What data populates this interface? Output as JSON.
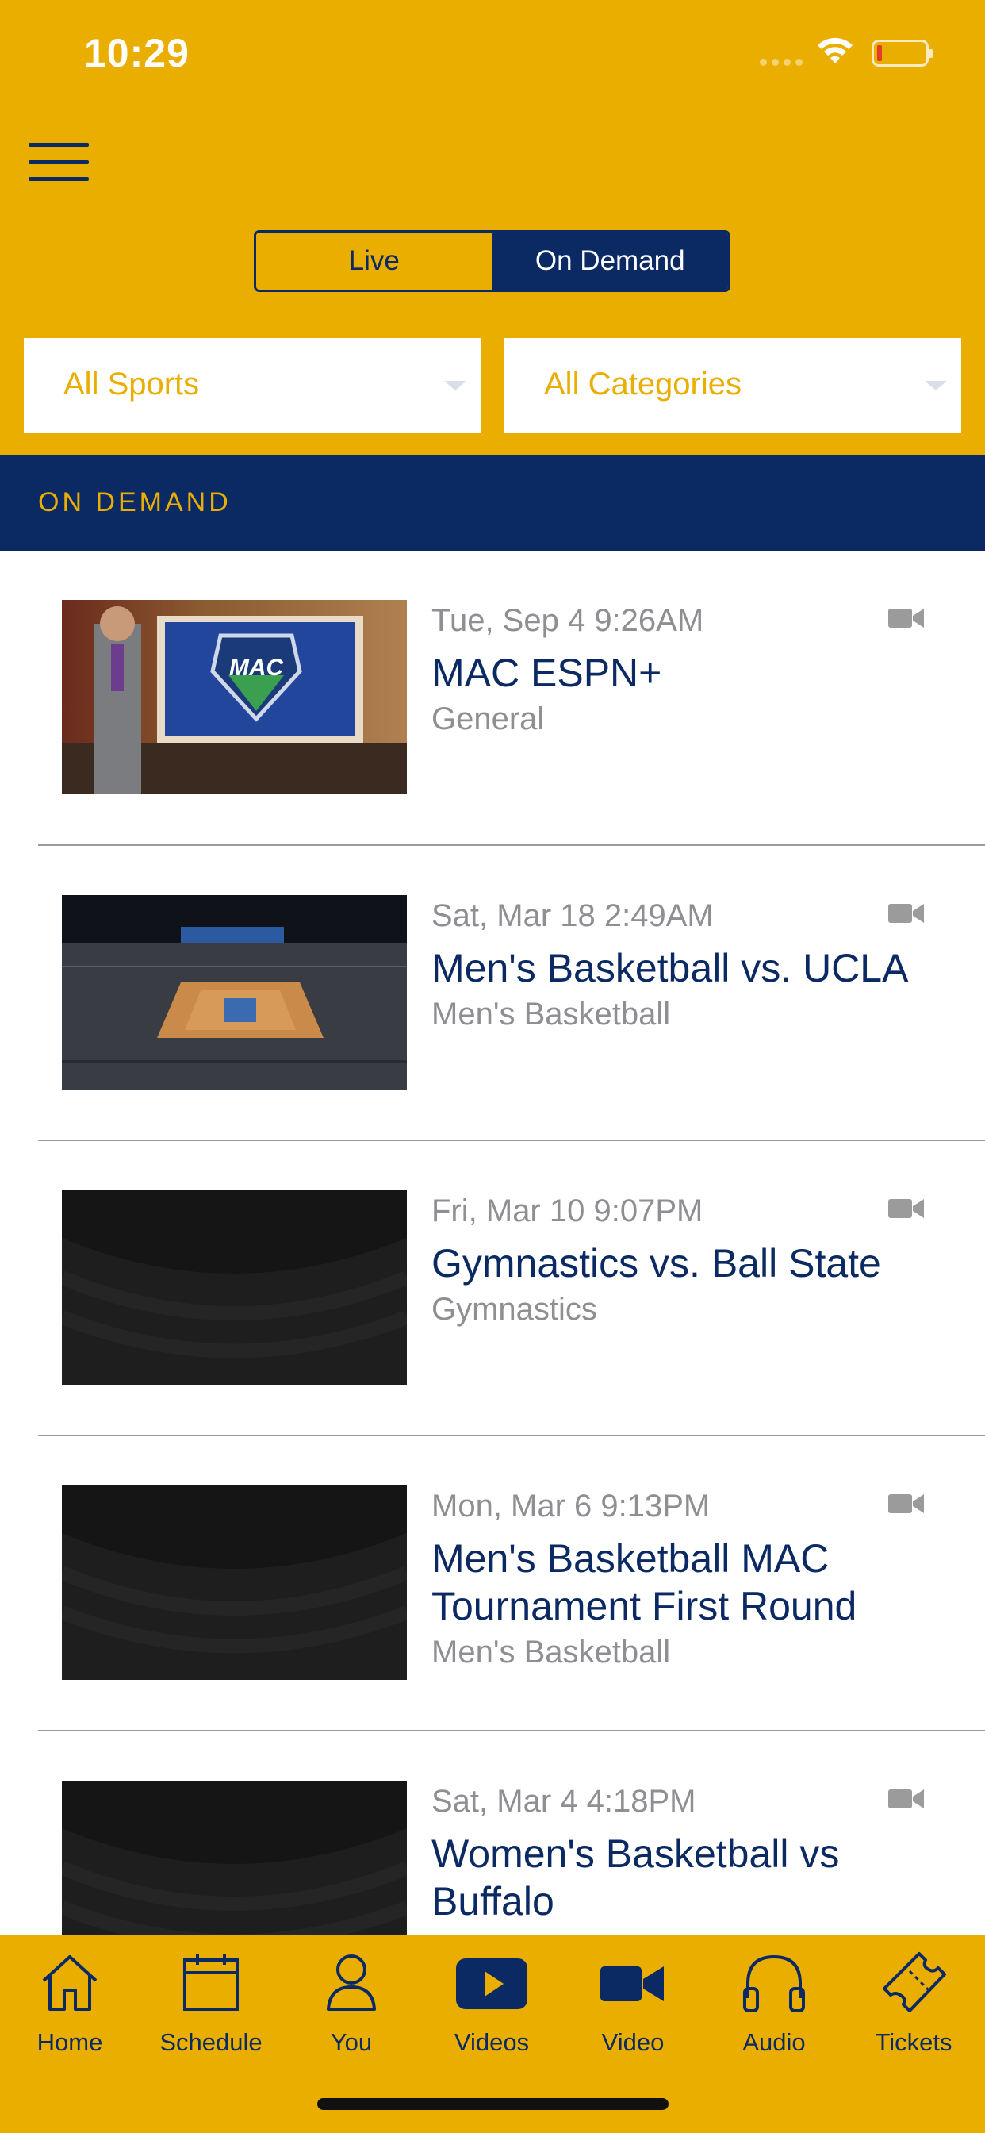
{
  "status": {
    "time": "10:29"
  },
  "segment": {
    "live_label": "Live",
    "ondemand_label": "On Demand",
    "selected": "On Demand"
  },
  "filters": {
    "sports": {
      "value": "All Sports"
    },
    "categories": {
      "value": "All Categories"
    }
  },
  "section": {
    "title": "ON DEMAND"
  },
  "videos": [
    {
      "date": "Tue, Sep 4 9:26AM",
      "title": "MAC ESPN+",
      "category": "General",
      "thumbnail": "studio-host-mac-logo"
    },
    {
      "date": "Sat, Mar 18 2:49AM",
      "title": "Men's Basketball vs. UCLA",
      "category": "Men's Basketball",
      "thumbnail": "arena-basketball-court"
    },
    {
      "date": "Fri, Mar 10 9:07PM",
      "title": "Gymnastics vs. Ball State",
      "category": "Gymnastics",
      "thumbnail": "dark-arena-seats"
    },
    {
      "date": "Mon, Mar 6 9:13PM",
      "title": "Men's Basketball MAC Tournament First Round",
      "category": "Men's Basketball",
      "thumbnail": "dark-arena-seats"
    },
    {
      "date": "Sat, Mar 4 4:18PM",
      "title": "Women's Basketball vs Buffalo",
      "category": "",
      "thumbnail": "dark-arena-seats"
    }
  ],
  "tabs": [
    {
      "label": "Home",
      "icon": "home-icon"
    },
    {
      "label": "Schedule",
      "icon": "calendar-icon"
    },
    {
      "label": "You",
      "icon": "person-icon"
    },
    {
      "label": "Videos",
      "icon": "play-icon",
      "active": true
    },
    {
      "label": "Video",
      "icon": "video-camera-icon"
    },
    {
      "label": "Audio",
      "icon": "headphones-icon"
    },
    {
      "label": "Tickets",
      "icon": "ticket-icon"
    }
  ],
  "colors": {
    "gold": "#E9AE00",
    "navy": "#0B2A63",
    "gray": "#8E8E93"
  }
}
